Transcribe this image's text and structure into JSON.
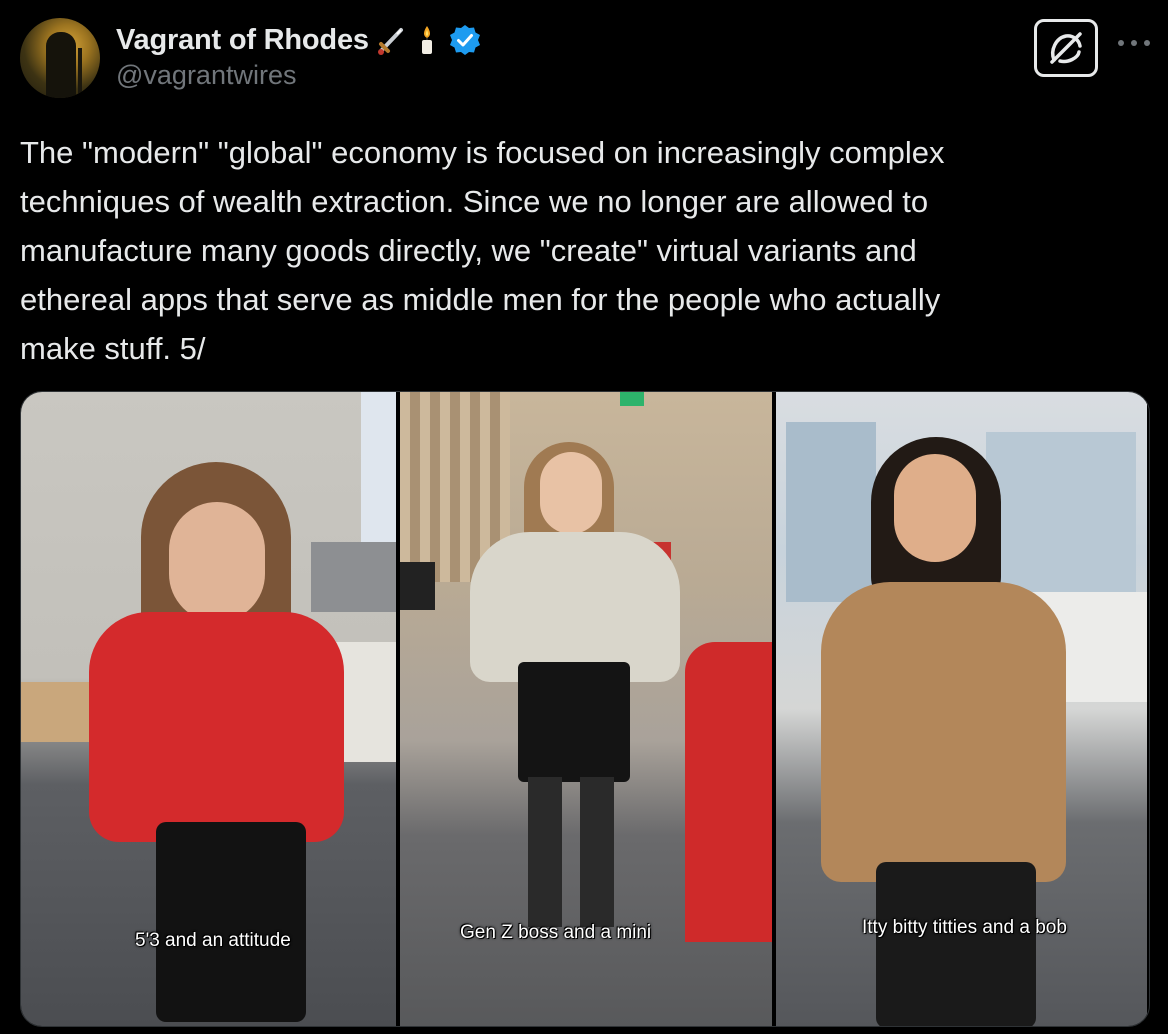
{
  "author": {
    "display_name": "Vagrant of Rhodes",
    "handle": "@vagrantwires",
    "verified_color": "#1d9bf0",
    "badges": [
      "sword-emoji",
      "candle-emoji",
      "verified-badge"
    ]
  },
  "actions": {
    "grok_icon": "slashed-square-icon",
    "more_label": "···"
  },
  "tweet": {
    "text": "The \"modern\" \"global\" economy is focused on increasingly complex\ntechniques of wealth extraction. Since we no longer are allowed to\nmanufacture many goods directly, we \"create\" virtual variants and\nethereal apps that serve as middle men for the people who actually\nmake stuff. 5/"
  },
  "media": {
    "panels": [
      {
        "caption": "5'3 and an attitude"
      },
      {
        "caption": "Gen Z boss and a mini"
      },
      {
        "caption": "Itty bitty titties and a bob"
      }
    ]
  }
}
